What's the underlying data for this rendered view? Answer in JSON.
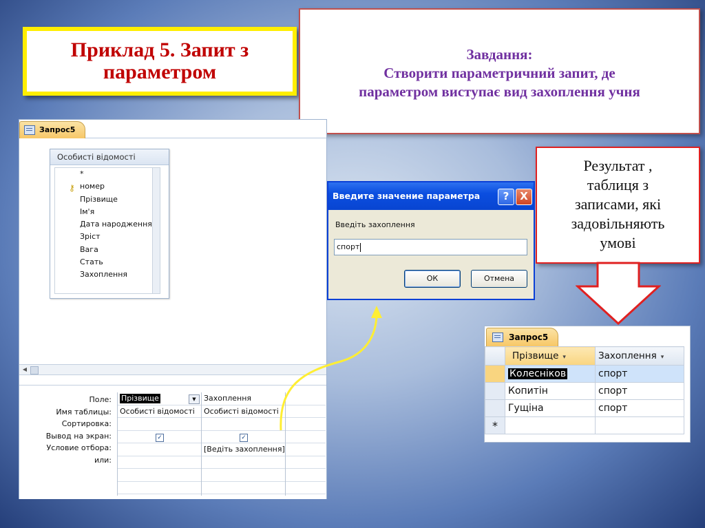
{
  "slide": {
    "title": "Приклад 5. Запит з\nпараметром",
    "task_heading": "Завдання:",
    "task_line1": "Створити параметричний запит,  де",
    "task_line2": "параметром виступає  вид захоплення учня",
    "result_line1": "Результат ,",
    "result_line2": "таблиця з",
    "result_line3": "записами, які",
    "result_line4": "задовільняють",
    "result_line5": "умові"
  },
  "design": {
    "tab_label": "Запрос5",
    "table_title": "Особисті відомості",
    "fields": [
      "*",
      "номер",
      "Прізвище",
      "Ім'я",
      "Дата народження",
      "Зріст",
      "Вага",
      "Стать",
      "Захоплення"
    ],
    "row_labels": [
      "Поле:",
      "Имя таблицы:",
      "Сортировка:",
      "Вывод на экран:",
      "Условие отбора:",
      "или:"
    ],
    "col1": {
      "field": "Прізвище",
      "table": "Особисті відомості"
    },
    "col2": {
      "field": "Захоплення",
      "table": "Особисті відомості",
      "criteria": "[Ведіть захоплення]"
    },
    "check_mark": "✓"
  },
  "dialog": {
    "title": "Введите значение параметра",
    "prompt": "Введіть захоплення",
    "value": "спорт",
    "ok": "ОК",
    "cancel": "Отмена",
    "help": "?",
    "close": "X"
  },
  "result": {
    "tab_label": "Запрос5",
    "headers": [
      "Прізвище",
      "Захоплення"
    ],
    "rows": [
      [
        "Колесніков",
        "спорт"
      ],
      [
        "Копитін",
        "спорт"
      ],
      [
        "Гущіна",
        "спорт"
      ]
    ],
    "new_row_marker": "*"
  },
  "colors": {
    "title_text": "#c00000",
    "title_border": "#ffee00",
    "task_text": "#7030a0",
    "callout_border": "#e02020",
    "curve_arrow": "#ffee33"
  }
}
